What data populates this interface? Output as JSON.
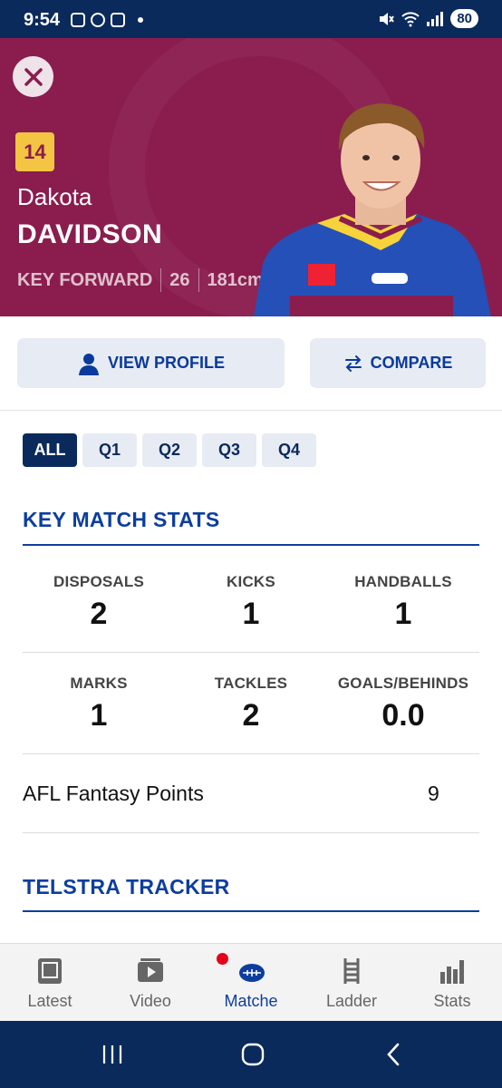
{
  "status_bar": {
    "time": "9:54",
    "battery": "80",
    "icons": [
      "screenshot-icon",
      "messenger-icon",
      "instagram-icon",
      "notification-dot",
      "mute-icon",
      "wifi-icon",
      "signal-icon"
    ]
  },
  "player": {
    "number": "14",
    "first_name": "Dakota",
    "last_name": "DAVIDSON",
    "position": "KEY FORWARD",
    "age": "26",
    "height": "181cm",
    "team_color": "#8a1d4e"
  },
  "actions": {
    "view_profile": "VIEW PROFILE",
    "compare": "COMPARE"
  },
  "tabs": [
    {
      "label": "ALL",
      "active": true
    },
    {
      "label": "Q1",
      "active": false
    },
    {
      "label": "Q2",
      "active": false
    },
    {
      "label": "Q3",
      "active": false
    },
    {
      "label": "Q4",
      "active": false
    }
  ],
  "key_match_stats": {
    "title": "KEY MATCH STATS",
    "stats": [
      {
        "label": "DISPOSALS",
        "value": "2"
      },
      {
        "label": "KICKS",
        "value": "1"
      },
      {
        "label": "HANDBALLS",
        "value": "1"
      },
      {
        "label": "MARKS",
        "value": "1"
      },
      {
        "label": "TACKLES",
        "value": "2"
      },
      {
        "label": "GOALS/BEHINDS",
        "value": "0.0"
      }
    ],
    "fantasy_label": "AFL Fantasy Points",
    "fantasy_value": "9"
  },
  "telstra_tracker": {
    "title": "TELSTRA TRACKER"
  },
  "bottom_nav": [
    {
      "label": "Latest",
      "icon": "tablet-icon",
      "active": false
    },
    {
      "label": "Video",
      "icon": "video-icon",
      "active": false
    },
    {
      "label": "Matche",
      "icon": "football-icon",
      "active": true
    },
    {
      "label": "Ladder",
      "icon": "ladder-icon",
      "active": false
    },
    {
      "label": "Stats",
      "icon": "bar-chart-icon",
      "active": false
    }
  ],
  "colors": {
    "accent": "#0d3e9e",
    "navy": "#0a2a5c",
    "badge": "#f4c542"
  }
}
